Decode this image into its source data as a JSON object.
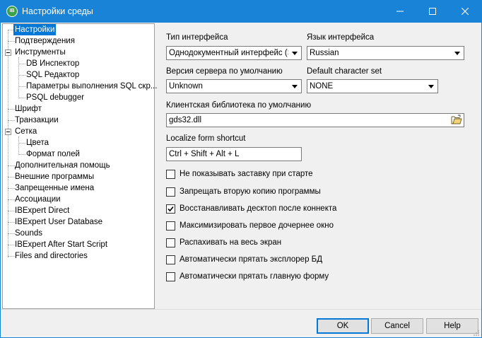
{
  "window": {
    "title": "Настройки среды",
    "app_icon": "IB",
    "icon": "ibexpert-logo-icon"
  },
  "tree": {
    "items": [
      {
        "label": "Настройки",
        "selected": true
      },
      {
        "label": "Подтверждения"
      },
      {
        "label": "Инструменты",
        "expanded": true
      },
      {
        "label": "DB Инспектор"
      },
      {
        "label": "SQL Редактор"
      },
      {
        "label": "Параметры выполнения SQL скр..."
      },
      {
        "label": "PSQL debugger"
      },
      {
        "label": "Шрифт"
      },
      {
        "label": "Транзакции"
      },
      {
        "label": "Сетка",
        "expanded": true
      },
      {
        "label": "Цвета"
      },
      {
        "label": "Формат полей"
      },
      {
        "label": "Дополнительная помощь"
      },
      {
        "label": "Внешние программы"
      },
      {
        "label": "Запрещенные имена"
      },
      {
        "label": "Ассоциации"
      },
      {
        "label": "IBExpert Direct"
      },
      {
        "label": "IBExpert User Database"
      },
      {
        "label": "Sounds"
      },
      {
        "label": "IBExpert After Start Script"
      },
      {
        "label": "Files and directories"
      }
    ]
  },
  "settings": {
    "interface_type": {
      "label": "Тип интерфейса",
      "value": "Однодокументный интерфейс (SD"
    },
    "interface_language": {
      "label": "Язык интерфейса",
      "value": "Russian"
    },
    "server_version": {
      "label": "Версия сервера по умолчанию",
      "value": "Unknown"
    },
    "default_charset": {
      "label": "Default character set",
      "value": "NONE"
    },
    "client_library": {
      "label": "Клиентская библиотека по умолчанию",
      "value": "gds32.dll"
    },
    "localize_shortcut": {
      "label": "Localize form shortcut",
      "value": "Ctrl + Shift + Alt + L"
    }
  },
  "checkboxes": [
    {
      "label": "Не показывать заставку при старте",
      "checked": false
    },
    {
      "label": "Запрещать вторую копию программы",
      "checked": false
    },
    {
      "label": "Восстанавливать десктоп после коннекта",
      "checked": true
    },
    {
      "label": "Максимизировать первое дочернее окно",
      "checked": false
    },
    {
      "label": "Распахивать на весь экран",
      "checked": false
    },
    {
      "label": "Автоматически прятать эксплорер БД",
      "checked": false
    },
    {
      "label": "Автоматически прятать главную форму",
      "checked": false
    }
  ],
  "buttons": {
    "ok": "OK",
    "cancel": "Cancel",
    "help": "Help"
  },
  "colors": {
    "titlebar": "#1883d7",
    "selection": "#0078d7"
  }
}
